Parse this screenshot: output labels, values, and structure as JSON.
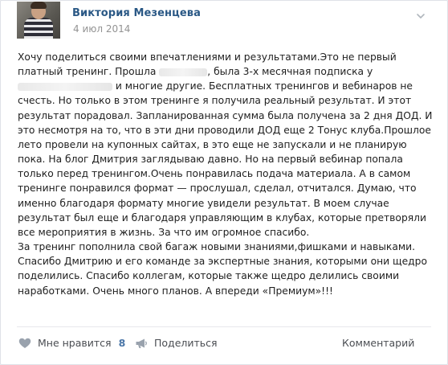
{
  "post": {
    "author": "Виктория Мезенцева",
    "date": "4 июл 2014",
    "text_parts": {
      "p1": "Хочу поделиться своими впечатлениями и результатами.Это не первый платный тренинг. Прошла ",
      "p2": ", была 3-х месячная подписка у ",
      "p3": " и многие другие. Бесплатных тренингов и вебинаров не счесть. Но только в этом тренинге я получила реальный результат. И этот результат порадовал. Запланированная сумма была получена за 2 дня ДОД. И это несмотря на то, что в эти дни проводили ДОД еще 2 Тонус клуба.Прошлое лето провели на купонных сайтах, в это еще не запускали и не планирую пока. На блог Дмитрия заглядываю давно. Но на первый вебинар попала только перед тренингом.Очень понравилась подача материала. А в самом тренинге понравился формат — прослушал, сделал, отчитался. Думаю, что именно благодаря формату многие увидели результат. В моем случае результат был еще и благодаря управляющим в клубах, которые претворяли все мероприятия в жизнь. За что им огромное спасибо.\nЗа тренинг пополнила свой багаж новыми знаниями,фишками и навыками. Спасибо Дмитрию и его команде за экспертные знания, которыми они щедро поделились. Спасибо коллегам, которые также щедро делились своими наработками. Очень много планов. А впереди «Премиум»!!!"
    }
  },
  "actions": {
    "like_label": "Мне нравится",
    "like_count": "8",
    "share_label": "Поделиться",
    "comment_label": "Комментарий"
  },
  "colors": {
    "author": "#2a5885",
    "accent": "#4a76a8",
    "icon": "#99a2ad"
  },
  "icons": {
    "more": "chevron-down-icon",
    "like": "heart-icon",
    "share": "megaphone-icon"
  }
}
